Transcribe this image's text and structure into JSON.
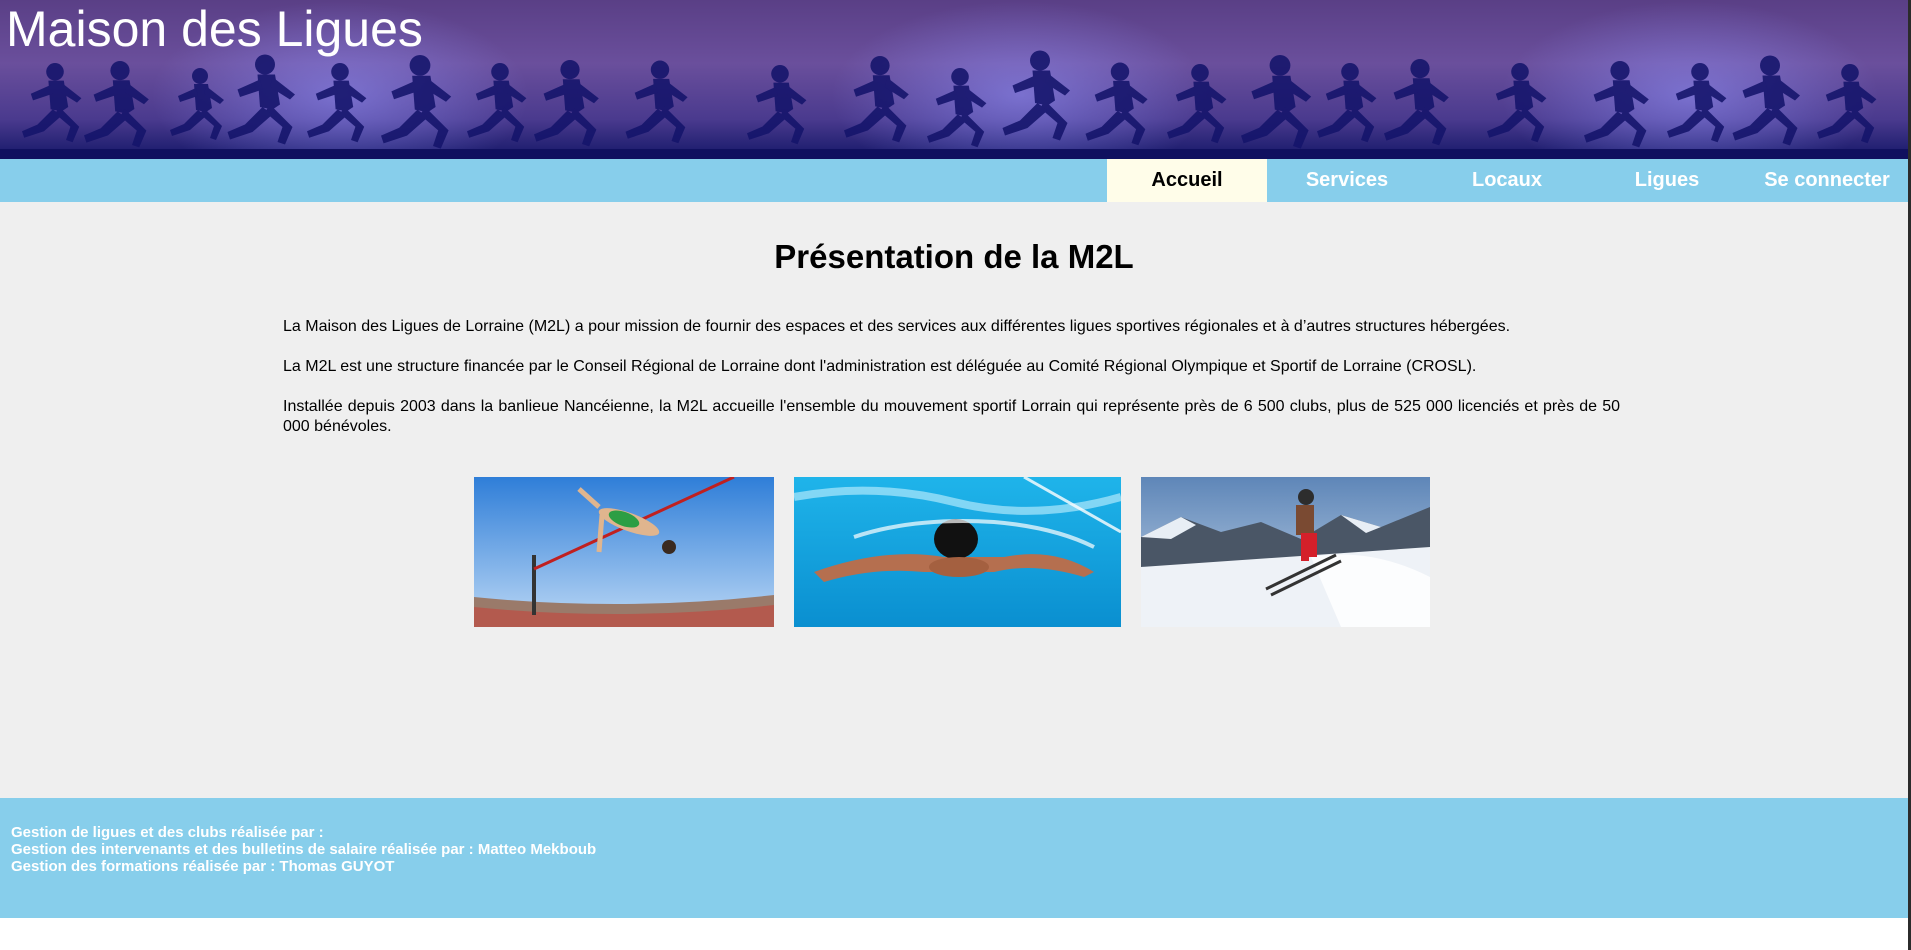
{
  "banner": {
    "title": "Maison des Ligues"
  },
  "nav": {
    "items": [
      {
        "label": "Accueil",
        "active": true
      },
      {
        "label": "Services",
        "active": false
      },
      {
        "label": "Locaux",
        "active": false
      },
      {
        "label": "Ligues",
        "active": false
      },
      {
        "label": "Se connecter",
        "active": false
      }
    ]
  },
  "main": {
    "heading": "Présentation de la M2L",
    "paragraphs": [
      "La Maison des Ligues de Lorraine (M2L) a pour mission de fournir des espaces et des services aux différentes ligues sportives régionales et à d’autres structures hébergées.",
      "La M2L est une structure financée par le Conseil Régional de Lorraine dont l'administration est déléguée au Comité Régional Olympique et Sportif de Lorraine (CROSL).",
      "Installée depuis 2003 dans la banlieue Nancéienne, la M2L accueille l'ensemble du mouvement sportif Lorrain qui représente près de 6 500 clubs, plus de 525 000 licenciés et près de 50 000 bénévoles."
    ],
    "photos": [
      {
        "icon": "high-jump-photo"
      },
      {
        "icon": "swimmer-photo"
      },
      {
        "icon": "skier-photo"
      }
    ]
  },
  "footer": {
    "lines": [
      "Gestion de ligues et des clubs réalisée par :",
      "Gestion des intervenants et des bulletins de salaire réalisée par : Matteo Mekboub",
      "Gestion des formations réalisée par : Thomas GUYOT"
    ]
  },
  "colors": {
    "nav_bg": "#87ceeb",
    "nav_active_bg": "#fffde9",
    "main_bg": "#efefef",
    "banner_dark": "#10105f"
  }
}
